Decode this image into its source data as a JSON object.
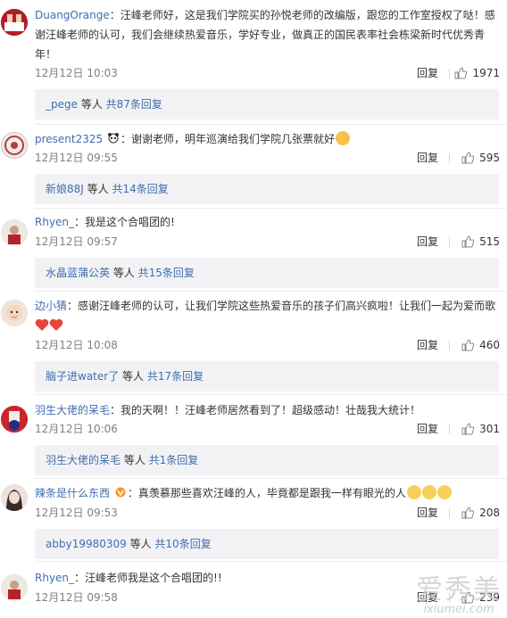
{
  "comments": [
    {
      "user": "DuangOrange",
      "text": "：汪峰老师好，这是我们学院买的孙悦老师的改编版，跟您的工作室授权了哒！感谢汪峰老师的认可，我们会继续热爱音乐，学好专业，做真正的国民表率社会栋梁新时代优秀青年！",
      "time": "12月12日 10:03",
      "reply_label": "回复",
      "likes": "1971",
      "replies_user": "_pege",
      "replies_mid": " 等人 ",
      "replies_count": "共87条回复"
    },
    {
      "user": "present2325",
      "text": "：谢谢老师，明年巡演给我们学院几张票就好",
      "time": "12月12日 09:55",
      "reply_label": "回复",
      "likes": "595",
      "replies_user": "新娘88J",
      "replies_mid": " 等人 ",
      "replies_count": "共14条回复"
    },
    {
      "user": "Rhyen_",
      "text": "：我是这个合唱团的!",
      "time": "12月12日 09:57",
      "reply_label": "回复",
      "likes": "515",
      "replies_user": "水晶蓝蒲公英",
      "replies_mid": " 等人 ",
      "replies_count": "共15条回复"
    },
    {
      "user": "边小猜",
      "text": "：感谢汪峰老师的认可，让我们学院这些热爱音乐的孩子们高兴疯啦！让我们一起为爱而歌",
      "time": "12月12日 10:08",
      "reply_label": "回复",
      "likes": "460",
      "replies_user": "脑子进water了",
      "replies_mid": " 等人 ",
      "replies_count": "共17条回复"
    },
    {
      "user": "羽生大佬的呆毛",
      "text": "：我的天啊！！汪峰老师居然看到了！超级感动！壮哉我大统计！",
      "time": "12月12日 10:06",
      "reply_label": "回复",
      "likes": "301",
      "replies_user": "羽生大佬的呆毛",
      "replies_mid": " 等人 ",
      "replies_count": "共1条回复"
    },
    {
      "user": "辣条是什么东西",
      "text": "：真羡慕那些喜欢汪峰的人，毕竟都是跟我一样有眼光的人",
      "time": "12月12日 09:53",
      "reply_label": "回复",
      "likes": "208",
      "replies_user": "abby19980309",
      "replies_mid": " 等人 ",
      "replies_count": "共10条回复"
    },
    {
      "user": "Rhyen_",
      "text": "：汪峰老师我是这个合唱团的!!",
      "time": "12月12日 09:58",
      "reply_label": "回复",
      "likes": "239"
    }
  ],
  "watermark": {
    "main": "爱秀美",
    "sub": "ixiumei.com"
  },
  "colors": {
    "link": "#3f6eaf",
    "reply_bg": "#f2f2f5",
    "meta": "#808080",
    "emoji": "#f6c24a",
    "heart": "#e6453a"
  },
  "icons": [
    "thumbs-up-icon",
    "vip-badge-icon",
    "panda-icon",
    "smile-emoji-icon",
    "heart-icon",
    "cat-emoji-icon"
  ]
}
